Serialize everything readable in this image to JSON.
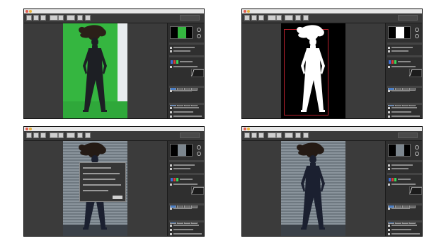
{
  "panels": [
    {
      "id": "top-left",
      "variant": "green-screen",
      "backdrop_color": "#35b640"
    },
    {
      "id": "top-right",
      "variant": "mask",
      "backdrop_color": "#000000",
      "mask_color": "#ffffff"
    },
    {
      "id": "bottom-left",
      "variant": "background-with-dialog",
      "backdrop_color": "#7c868e",
      "dialog_open": true
    },
    {
      "id": "bottom-right",
      "variant": "background-composite",
      "backdrop_color": "#7c868e",
      "dialog_open": false
    }
  ],
  "toolbar": {
    "icons": [
      "tool-icon",
      "tool-icon",
      "brush-icon",
      "person-icon",
      "tool-icon",
      "tool-icon",
      "hand-icon",
      "zoom-icon",
      "search-field"
    ]
  },
  "sidebar": {
    "sections": [
      "preview",
      "settings",
      "color",
      "histogram",
      "presets",
      "background",
      "export"
    ]
  },
  "colors": {
    "window": "#2a2a2a",
    "toolbar": "#3a3a3a",
    "titlebar": "#e7e7e7",
    "green_screen": "#35b640",
    "mask_border": "#b8202c"
  }
}
